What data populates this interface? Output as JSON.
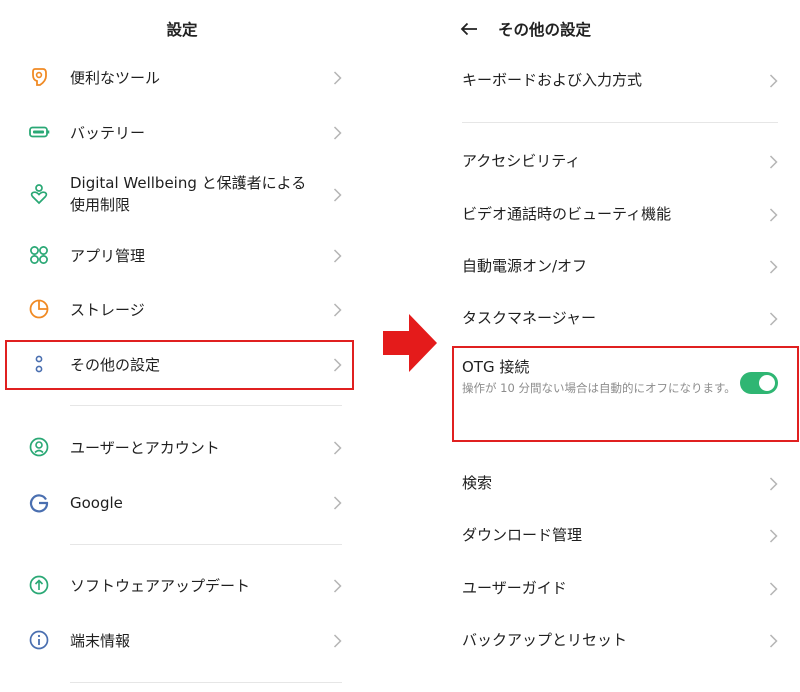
{
  "left": {
    "title": "設定",
    "items": [
      {
        "label": "便利なツール",
        "icon": "tools-icon"
      },
      {
        "label": "バッテリー",
        "icon": "battery-icon"
      },
      {
        "label": "Digital Wellbeing と保護者による",
        "label2": "使用制限",
        "icon": "wellbeing-icon"
      },
      {
        "label": "アプリ管理",
        "icon": "apps-icon"
      },
      {
        "label": "ストレージ",
        "icon": "storage-icon"
      },
      {
        "label": "その他の設定",
        "icon": "more-settings-icon",
        "highlighted": true
      },
      {
        "label": "ユーザーとアカウント",
        "icon": "user-accounts-icon"
      },
      {
        "label": "Google",
        "icon": "google-icon"
      },
      {
        "label": "ソフトウェアアップデート",
        "icon": "software-update-icon"
      },
      {
        "label": "端末情報",
        "icon": "info-icon"
      }
    ]
  },
  "right": {
    "title": "その他の設定",
    "items": [
      {
        "label": "キーボードおよび入力方式"
      },
      {
        "label": "アクセシビリティ"
      },
      {
        "label": "ビデオ通話時のビューティ機能"
      },
      {
        "label": "自動電源オン/オフ"
      },
      {
        "label": "タスクマネージャー"
      },
      {
        "label": "検索"
      },
      {
        "label": "ダウンロード管理"
      },
      {
        "label": "ユーザーガイド"
      },
      {
        "label": "バックアップとリセット"
      }
    ],
    "otg": {
      "title": "OTG 接続",
      "description": "操作が 10 分間ない場合は自動的にオフになります。",
      "enabled": true
    }
  },
  "colors": {
    "highlight": "#e02020",
    "toggle_on": "#2fb673",
    "icon_orange": "#f08a24",
    "icon_green": "#2aa875",
    "icon_blue": "#4a6fb0"
  }
}
